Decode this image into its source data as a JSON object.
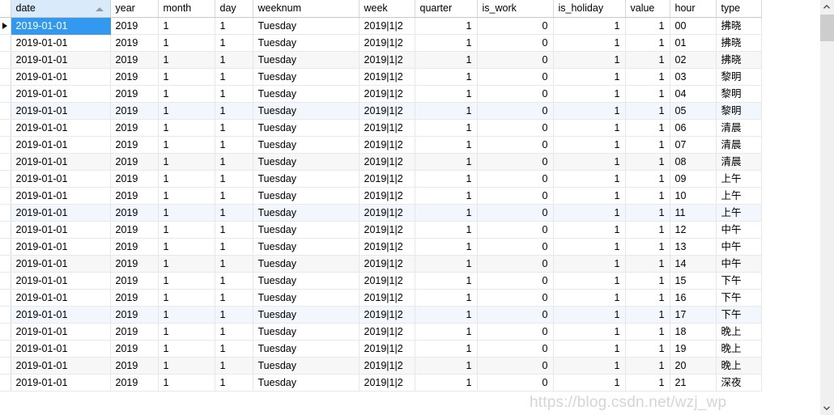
{
  "grid": {
    "sorted_column": "date",
    "sort_direction": "ascending",
    "selected_row_index": 0,
    "row_marker_icon": "play-triangle-icon",
    "sort_icon": "sort-ascending-triangle-icon",
    "colors": {
      "selection": "#3399f0",
      "sorted_header": "#d9ebfb",
      "stripe_gray": "#f7f7f7",
      "stripe_blue": "#f1f7fd",
      "grid_line": "#e6e6e6"
    },
    "columns": [
      {
        "key": "date",
        "label": "date",
        "align": "left"
      },
      {
        "key": "year",
        "label": "year",
        "align": "left"
      },
      {
        "key": "month",
        "label": "month",
        "align": "left"
      },
      {
        "key": "day",
        "label": "day",
        "align": "left"
      },
      {
        "key": "weeknum",
        "label": "weeknum",
        "align": "left"
      },
      {
        "key": "week",
        "label": "week",
        "align": "left"
      },
      {
        "key": "quarter",
        "label": "quarter",
        "align": "right"
      },
      {
        "key": "is_work",
        "label": "is_work",
        "align": "right"
      },
      {
        "key": "is_holiday",
        "label": "is_holiday",
        "align": "right"
      },
      {
        "key": "value",
        "label": "value",
        "align": "right"
      },
      {
        "key": "hour",
        "label": "hour",
        "align": "left"
      },
      {
        "key": "type",
        "label": "type",
        "align": "left"
      }
    ],
    "rows": [
      {
        "date": "2019-01-01",
        "year": "2019",
        "month": "1",
        "day": "1",
        "weeknum": "Tuesday",
        "week": "2019|1|2",
        "quarter": "1",
        "is_work": "0",
        "is_holiday": "1",
        "value": "1",
        "hour": "00",
        "type": "拂晓"
      },
      {
        "date": "2019-01-01",
        "year": "2019",
        "month": "1",
        "day": "1",
        "weeknum": "Tuesday",
        "week": "2019|1|2",
        "quarter": "1",
        "is_work": "0",
        "is_holiday": "1",
        "value": "1",
        "hour": "01",
        "type": "拂晓"
      },
      {
        "date": "2019-01-01",
        "year": "2019",
        "month": "1",
        "day": "1",
        "weeknum": "Tuesday",
        "week": "2019|1|2",
        "quarter": "1",
        "is_work": "0",
        "is_holiday": "1",
        "value": "1",
        "hour": "02",
        "type": "拂晓"
      },
      {
        "date": "2019-01-01",
        "year": "2019",
        "month": "1",
        "day": "1",
        "weeknum": "Tuesday",
        "week": "2019|1|2",
        "quarter": "1",
        "is_work": "0",
        "is_holiday": "1",
        "value": "1",
        "hour": "03",
        "type": "黎明"
      },
      {
        "date": "2019-01-01",
        "year": "2019",
        "month": "1",
        "day": "1",
        "weeknum": "Tuesday",
        "week": "2019|1|2",
        "quarter": "1",
        "is_work": "0",
        "is_holiday": "1",
        "value": "1",
        "hour": "04",
        "type": "黎明"
      },
      {
        "date": "2019-01-01",
        "year": "2019",
        "month": "1",
        "day": "1",
        "weeknum": "Tuesday",
        "week": "2019|1|2",
        "quarter": "1",
        "is_work": "0",
        "is_holiday": "1",
        "value": "1",
        "hour": "05",
        "type": "黎明"
      },
      {
        "date": "2019-01-01",
        "year": "2019",
        "month": "1",
        "day": "1",
        "weeknum": "Tuesday",
        "week": "2019|1|2",
        "quarter": "1",
        "is_work": "0",
        "is_holiday": "1",
        "value": "1",
        "hour": "06",
        "type": "清晨"
      },
      {
        "date": "2019-01-01",
        "year": "2019",
        "month": "1",
        "day": "1",
        "weeknum": "Tuesday",
        "week": "2019|1|2",
        "quarter": "1",
        "is_work": "0",
        "is_holiday": "1",
        "value": "1",
        "hour": "07",
        "type": "清晨"
      },
      {
        "date": "2019-01-01",
        "year": "2019",
        "month": "1",
        "day": "1",
        "weeknum": "Tuesday",
        "week": "2019|1|2",
        "quarter": "1",
        "is_work": "0",
        "is_holiday": "1",
        "value": "1",
        "hour": "08",
        "type": "清晨"
      },
      {
        "date": "2019-01-01",
        "year": "2019",
        "month": "1",
        "day": "1",
        "weeknum": "Tuesday",
        "week": "2019|1|2",
        "quarter": "1",
        "is_work": "0",
        "is_holiday": "1",
        "value": "1",
        "hour": "09",
        "type": "上午"
      },
      {
        "date": "2019-01-01",
        "year": "2019",
        "month": "1",
        "day": "1",
        "weeknum": "Tuesday",
        "week": "2019|1|2",
        "quarter": "1",
        "is_work": "0",
        "is_holiday": "1",
        "value": "1",
        "hour": "10",
        "type": "上午"
      },
      {
        "date": "2019-01-01",
        "year": "2019",
        "month": "1",
        "day": "1",
        "weeknum": "Tuesday",
        "week": "2019|1|2",
        "quarter": "1",
        "is_work": "0",
        "is_holiday": "1",
        "value": "1",
        "hour": "11",
        "type": "上午"
      },
      {
        "date": "2019-01-01",
        "year": "2019",
        "month": "1",
        "day": "1",
        "weeknum": "Tuesday",
        "week": "2019|1|2",
        "quarter": "1",
        "is_work": "0",
        "is_holiday": "1",
        "value": "1",
        "hour": "12",
        "type": "中午"
      },
      {
        "date": "2019-01-01",
        "year": "2019",
        "month": "1",
        "day": "1",
        "weeknum": "Tuesday",
        "week": "2019|1|2",
        "quarter": "1",
        "is_work": "0",
        "is_holiday": "1",
        "value": "1",
        "hour": "13",
        "type": "中午"
      },
      {
        "date": "2019-01-01",
        "year": "2019",
        "month": "1",
        "day": "1",
        "weeknum": "Tuesday",
        "week": "2019|1|2",
        "quarter": "1",
        "is_work": "0",
        "is_holiday": "1",
        "value": "1",
        "hour": "14",
        "type": "中午"
      },
      {
        "date": "2019-01-01",
        "year": "2019",
        "month": "1",
        "day": "1",
        "weeknum": "Tuesday",
        "week": "2019|1|2",
        "quarter": "1",
        "is_work": "0",
        "is_holiday": "1",
        "value": "1",
        "hour": "15",
        "type": "下午"
      },
      {
        "date": "2019-01-01",
        "year": "2019",
        "month": "1",
        "day": "1",
        "weeknum": "Tuesday",
        "week": "2019|1|2",
        "quarter": "1",
        "is_work": "0",
        "is_holiday": "1",
        "value": "1",
        "hour": "16",
        "type": "下午"
      },
      {
        "date": "2019-01-01",
        "year": "2019",
        "month": "1",
        "day": "1",
        "weeknum": "Tuesday",
        "week": "2019|1|2",
        "quarter": "1",
        "is_work": "0",
        "is_holiday": "1",
        "value": "1",
        "hour": "17",
        "type": "下午"
      },
      {
        "date": "2019-01-01",
        "year": "2019",
        "month": "1",
        "day": "1",
        "weeknum": "Tuesday",
        "week": "2019|1|2",
        "quarter": "1",
        "is_work": "0",
        "is_holiday": "1",
        "value": "1",
        "hour": "18",
        "type": "晚上"
      },
      {
        "date": "2019-01-01",
        "year": "2019",
        "month": "1",
        "day": "1",
        "weeknum": "Tuesday",
        "week": "2019|1|2",
        "quarter": "1",
        "is_work": "0",
        "is_holiday": "1",
        "value": "1",
        "hour": "19",
        "type": "晚上"
      },
      {
        "date": "2019-01-01",
        "year": "2019",
        "month": "1",
        "day": "1",
        "weeknum": "Tuesday",
        "week": "2019|1|2",
        "quarter": "1",
        "is_work": "0",
        "is_holiday": "1",
        "value": "1",
        "hour": "20",
        "type": "晚上"
      },
      {
        "date": "2019-01-01",
        "year": "2019",
        "month": "1",
        "day": "1",
        "weeknum": "Tuesday",
        "week": "2019|1|2",
        "quarter": "1",
        "is_work": "0",
        "is_holiday": "1",
        "value": "1",
        "hour": "21",
        "type": "深夜"
      }
    ]
  },
  "scrollbar": {
    "up_arrow_icon": "chevron-up-icon",
    "down_arrow_icon": "chevron-down-icon",
    "thumb_name": "scrollbar-thumb"
  },
  "watermark": {
    "text": "https://blog.csdn.net/wzj_wp"
  }
}
